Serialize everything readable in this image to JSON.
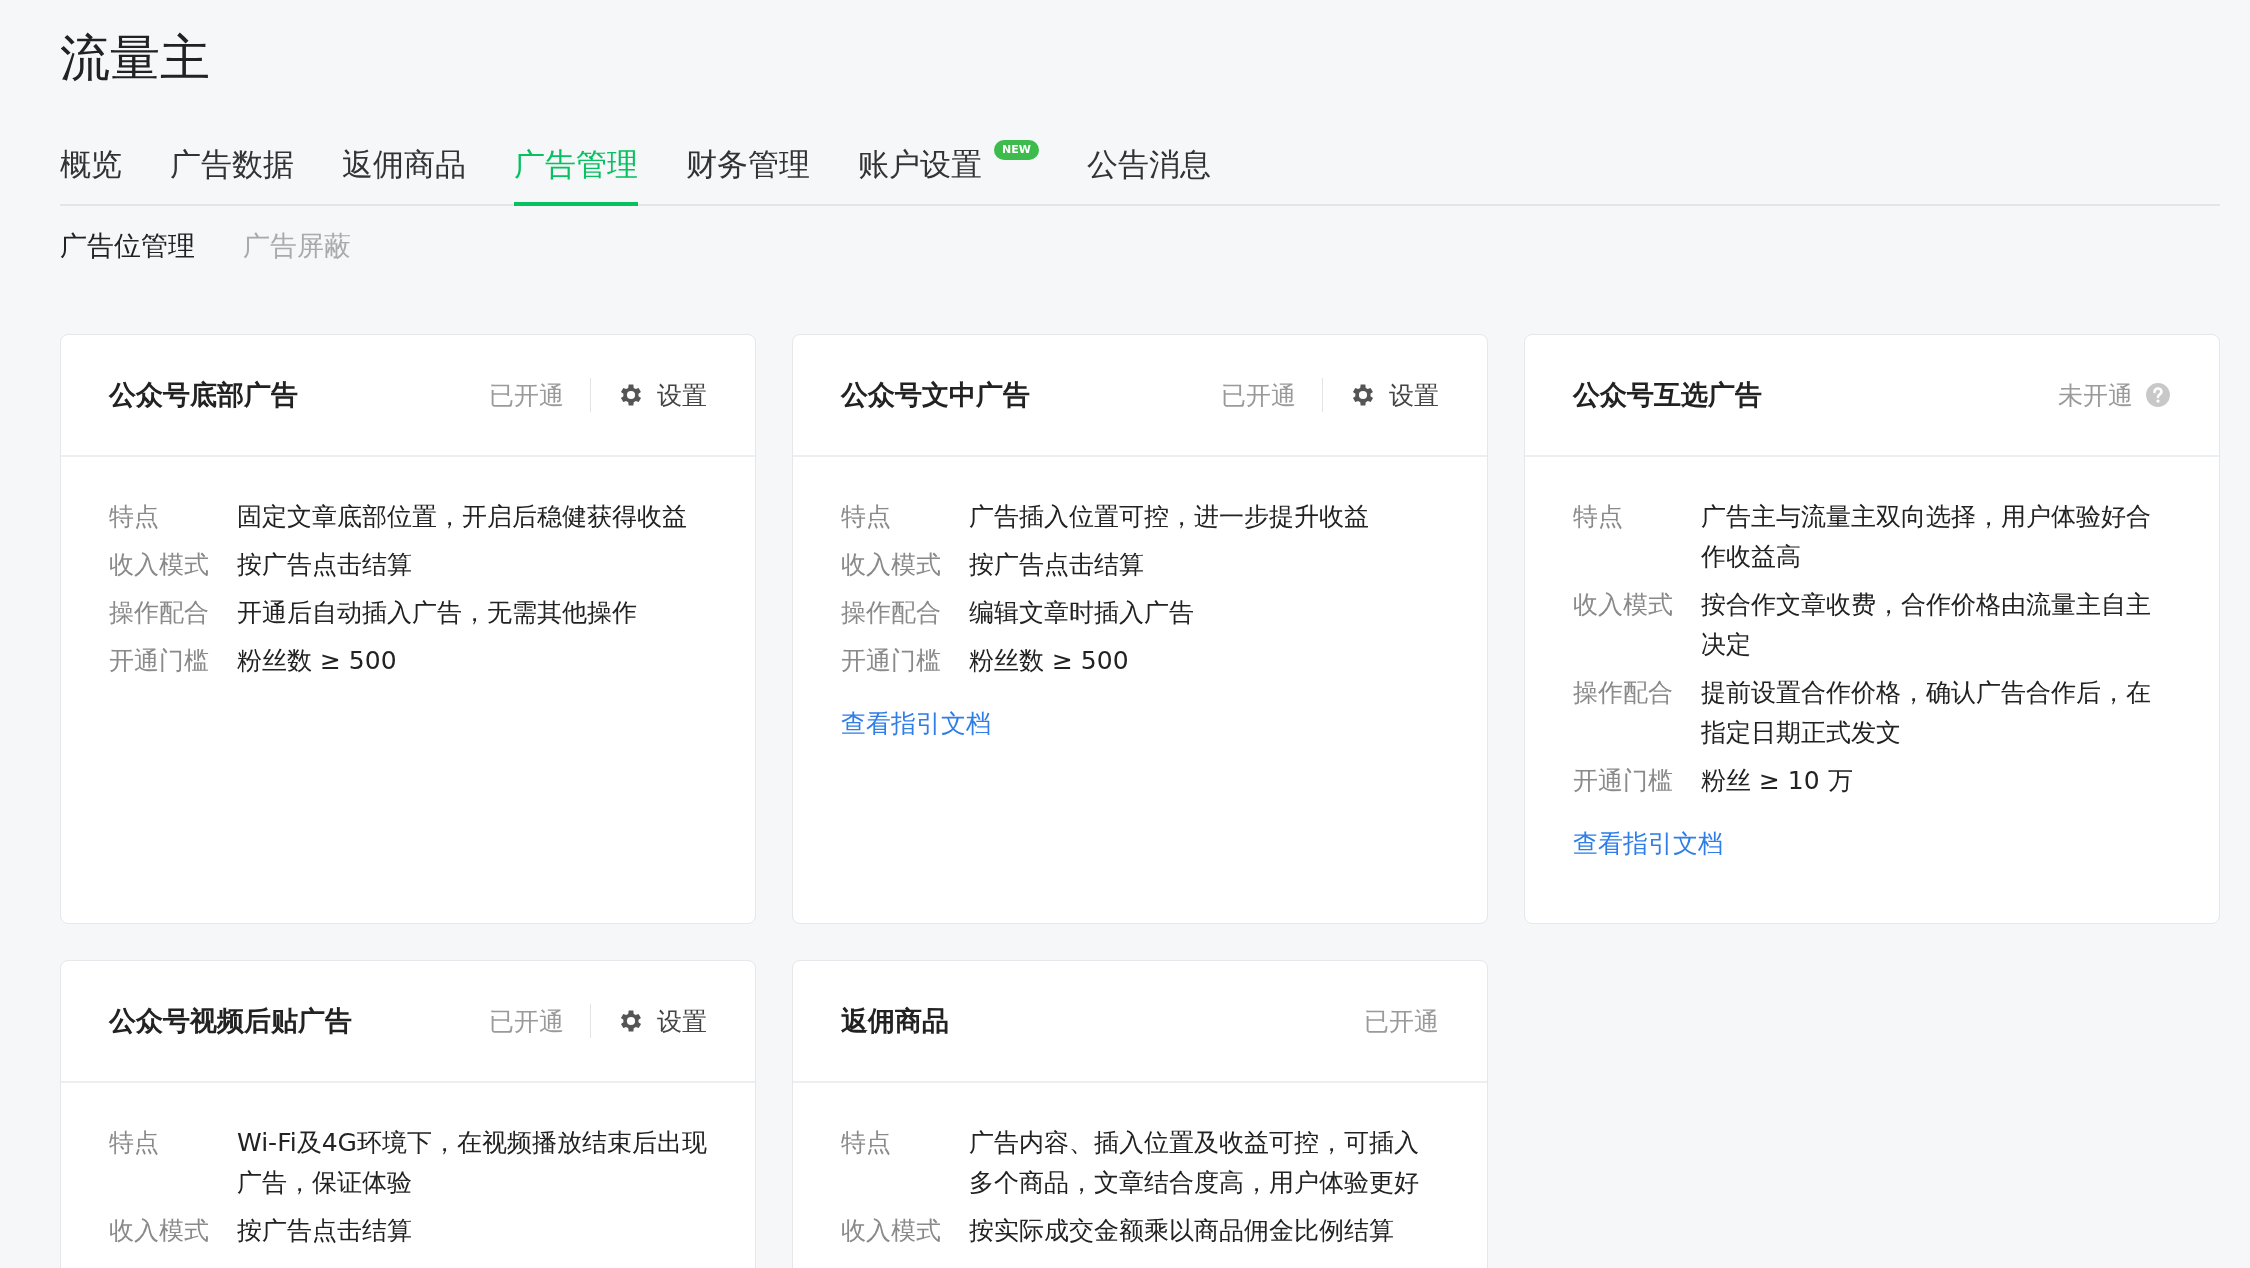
{
  "title": "流量主",
  "tabs": [
    {
      "label": "概览",
      "selected": false
    },
    {
      "label": "广告数据",
      "selected": false
    },
    {
      "label": "返佣商品",
      "selected": false
    },
    {
      "label": "广告管理",
      "selected": true
    },
    {
      "label": "财务管理",
      "selected": false
    },
    {
      "label": "账户设置",
      "selected": false,
      "badge": "NEW"
    },
    {
      "label": "公告消息",
      "selected": false
    }
  ],
  "subtabs": [
    {
      "label": "广告位管理",
      "selected": true
    },
    {
      "label": "广告屏蔽",
      "selected": false
    }
  ],
  "cards": [
    {
      "title": "公众号底部广告",
      "status": "已开通",
      "settings": "设置",
      "rows": [
        {
          "label": "特点",
          "value": "固定文章底部位置，开启后稳健获得收益"
        },
        {
          "label": "收入模式",
          "value": "按广告点击结算"
        },
        {
          "label": "操作配合",
          "value": "开通后自动插入广告，无需其他操作"
        },
        {
          "label": "开通门槛",
          "value": "粉丝数 ≥ 500"
        }
      ]
    },
    {
      "title": "公众号文中广告",
      "status": "已开通",
      "settings": "设置",
      "rows": [
        {
          "label": "特点",
          "value": "广告插入位置可控，进一步提升收益"
        },
        {
          "label": "收入模式",
          "value": "按广告点击结算"
        },
        {
          "label": "操作配合",
          "value": "编辑文章时插入广告"
        },
        {
          "label": "开通门槛",
          "value": "粉丝数 ≥ 500"
        }
      ],
      "link": "查看指引文档"
    },
    {
      "title": "公众号互选广告",
      "status": "未开通",
      "help": true,
      "rows": [
        {
          "label": "特点",
          "value": "广告主与流量主双向选择，用户体验好合作收益高"
        },
        {
          "label": "收入模式",
          "value": "按合作文章收费，合作价格由流量主自主决定"
        },
        {
          "label": "操作配合",
          "value": "提前设置合作价格，确认广告合作后，在指定日期正式发文"
        },
        {
          "label": "开通门槛",
          "value": "粉丝 ≥ 10 万"
        }
      ],
      "link": "查看指引文档"
    },
    {
      "title": "公众号视频后贴广告",
      "status": "已开通",
      "settings": "设置",
      "rows": [
        {
          "label": "特点",
          "value": "Wi-Fi及4G环境下，在视频播放结束后出现广告，保证体验"
        },
        {
          "label": "收入模式",
          "value": "按广告点击结算"
        }
      ]
    },
    {
      "title": "返佣商品",
      "status": "已开通",
      "rows": [
        {
          "label": "特点",
          "value": "广告内容、插入位置及收益可控，可插入多个商品，文章结合度高，用户体验更好"
        },
        {
          "label": "收入模式",
          "value": "按实际成交金额乘以商品佣金比例结算"
        }
      ]
    }
  ]
}
